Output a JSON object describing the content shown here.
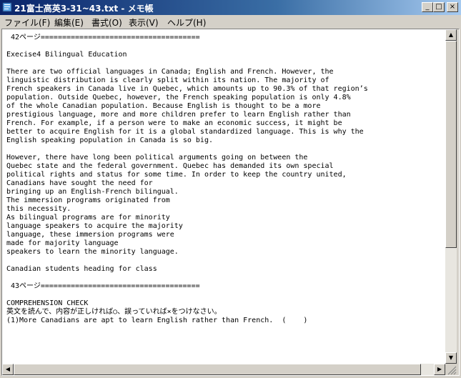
{
  "window": {
    "title": "21富士高英3-31~43.txt - メモ帳",
    "icon": "notepad-icon",
    "minimize_glyph": "_",
    "maximize_glyph": "□",
    "close_glyph": "×"
  },
  "menu": [
    {
      "label": "ファイル(F)"
    },
    {
      "label": "編集(E)"
    },
    {
      "label": "書式(O)"
    },
    {
      "label": "表示(V)"
    },
    {
      "label": "ヘルプ(H)"
    }
  ],
  "document": {
    "lines": [
      " 42ページ=====================================",
      "",
      "Execise4 Bilingual Education",
      "",
      "There are two official languages in Canada; English and French. However, the",
      "linguistic distribution is clearly split within its nation. The majority of",
      "French speakers in Canada live in Quebec, which amounts up to 90.3% of that region’s",
      "population. Outside Quebec, however, the French speaking population is only 4.8%",
      "of the whole Canadian population. Because English is thought to be a more",
      "prestigious language, more and more children prefer to learn English rather than",
      "French. For example, if a person were to make an economic success, it might be",
      "better to acquire English for it is a global standardized language. This is why the",
      "English speaking population in Canada is so big.",
      "",
      "However, there have long been political arguments going on between the",
      "Quebec state and the federal government. Quebec has demanded its own special",
      "political rights and status for some time. In order to keep the country united,",
      "Canadians have sought the need for",
      "bringing up an English-French bilingual.",
      "The immersion programs originated from",
      "this necessity.",
      "As bilingual programs are for minority",
      "language speakers to acquire the majority",
      "language, these immersion programs were",
      "made for majority language",
      "speakers to learn the minority language.",
      "",
      "Canadian students heading for class",
      "",
      " 43ページ=====================================",
      "",
      "COMPREHENSION CHECK",
      "英文を読んで、内容が正しければ○、誤っていれば×をつけなさい。",
      "(1)More Canadians are apt to learn English rather than French.  (    )"
    ]
  },
  "scrollbars": {
    "vertical": {
      "up_glyph": "▲",
      "down_glyph": "▼",
      "position": 0.0
    },
    "horizontal": {
      "left_glyph": "◀",
      "right_glyph": "▶",
      "position": 0.0
    }
  }
}
